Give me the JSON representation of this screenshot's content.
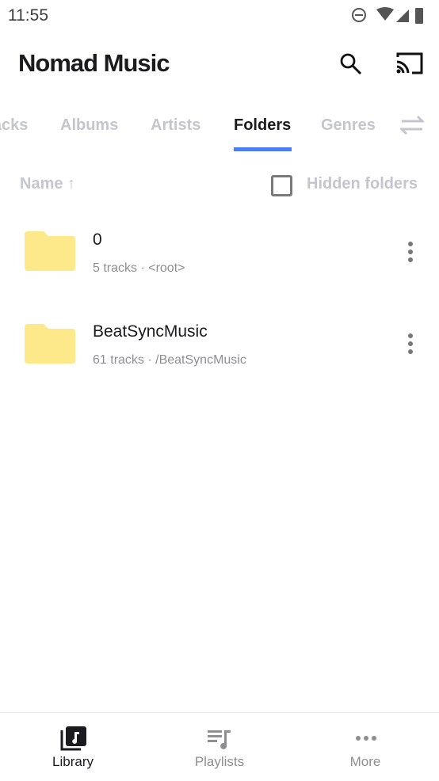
{
  "status": {
    "time": "11:55"
  },
  "header": {
    "title": "Nomad Music"
  },
  "tabs": [
    {
      "label": "Tracks"
    },
    {
      "label": "Albums"
    },
    {
      "label": "Artists"
    },
    {
      "label": "Folders",
      "active": true
    },
    {
      "label": "Genres"
    }
  ],
  "sort": {
    "label": "Name ↑"
  },
  "hidden_folders": {
    "label": "Hidden folders",
    "checked": false
  },
  "folders": [
    {
      "name": "0",
      "subtitle": "5 tracks · <root>"
    },
    {
      "name": "BeatSyncMusic",
      "subtitle": "61 tracks · /BeatSyncMusic"
    }
  ],
  "nav": [
    {
      "label": "Library",
      "active": true
    },
    {
      "label": "Playlists"
    },
    {
      "label": "More"
    }
  ],
  "colors": {
    "accent": "#4a7cf5",
    "folder": "#fde98a"
  }
}
